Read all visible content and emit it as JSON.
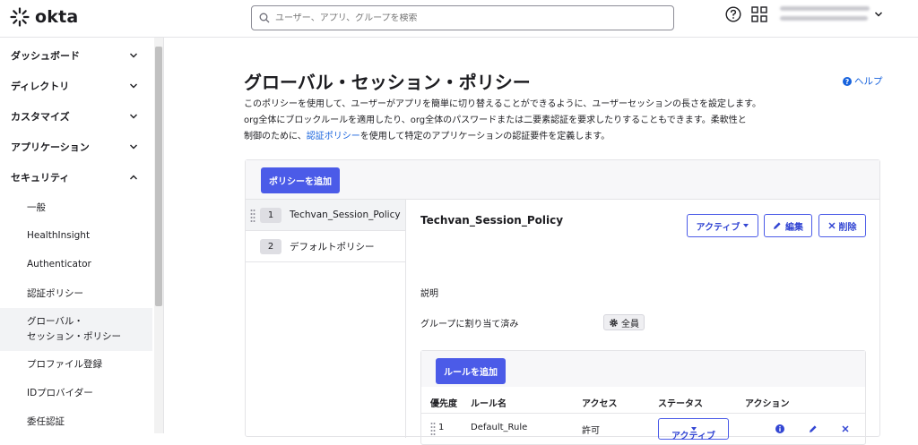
{
  "app": {
    "logo_text": "okta"
  },
  "search": {
    "placeholder": "ユーザー、アプリ、グループを検索"
  },
  "sidebar": {
    "sections": [
      {
        "label": "ダッシュボード",
        "state": "collapsed"
      },
      {
        "label": "ディレクトリ",
        "state": "collapsed"
      },
      {
        "label": "カスタマイズ",
        "state": "collapsed"
      },
      {
        "label": "アプリケーション",
        "state": "collapsed"
      },
      {
        "label": "セキュリティ",
        "state": "expanded"
      }
    ],
    "security_items": [
      "一般",
      "HealthInsight",
      "Authenticator",
      "認証ポリシー",
      "グローバル・\nセッション・ポリシー",
      "プロファイル登録",
      "IDプロバイダー",
      "委任認証"
    ]
  },
  "page": {
    "title": "グローバル・セッション・ポリシー",
    "help_label": "ヘルプ",
    "description_line1": "このポリシーを使用して、ユーザーがアプリを簡単に切り替えることができるように、ユーザーセッションの長さを設定します。",
    "description_line2": "org全体にブロックルールを適用したり、org全体のパスワードまたは二要素認証を要求したりすることもできます。柔軟性と",
    "description_line3_pre": "制御のために、",
    "description_link": "認証ポリシー",
    "description_line3_post": "を使用して特定のアプリケーションの認証要件を定義します。"
  },
  "policies": {
    "add_button": "ポリシーを追加",
    "items": [
      {
        "number": "1",
        "name": "Techvan_Session_Policy"
      },
      {
        "number": "2",
        "name": "デフォルトポリシー"
      }
    ]
  },
  "detail": {
    "title": "Techvan_Session_Policy",
    "status_button": "アクティブ",
    "edit_button": "編集",
    "delete_button": "削除",
    "description_label": "説明",
    "assigned_label": "グループに割り当て済み",
    "assigned_value": "全員"
  },
  "rules": {
    "add_button": "ルールを追加",
    "columns": [
      "優先度",
      "ルール名",
      "アクセス",
      "ステータス",
      "アクション"
    ],
    "rows": [
      {
        "priority": "1",
        "name": "Default_Rule",
        "access": "許可",
        "status": "アクティブ"
      }
    ]
  },
  "colors": {
    "primary": "#4b5be8",
    "link": "#1662dd"
  }
}
